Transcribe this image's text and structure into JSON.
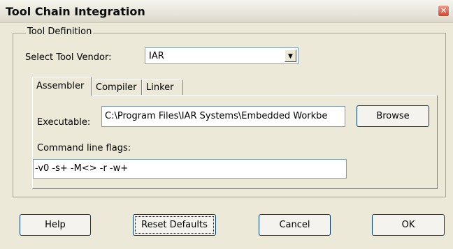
{
  "window": {
    "title": "Tool Chain Integration",
    "close_glyph": "✕"
  },
  "tool_definition": {
    "legend": "Tool Definition",
    "vendor_label": "Select Tool Vendor:",
    "vendor_value": "IAR",
    "dropdown_glyph": "▼"
  },
  "tabs": [
    {
      "label": "Assembler",
      "active": true
    },
    {
      "label": "Compiler",
      "active": false
    },
    {
      "label": "Linker",
      "active": false
    }
  ],
  "assembler": {
    "executable_label": "Executable:",
    "executable_value": "C:\\Program Files\\IAR Systems\\Embedded Workbe",
    "browse_label": "Browse",
    "flags_label": "Command line flags:",
    "flags_value": "-v0 -s+ -M<> -r -w+"
  },
  "buttons": {
    "help": "Help",
    "reset": "Reset Defaults",
    "cancel": "Cancel",
    "ok": "OK"
  }
}
